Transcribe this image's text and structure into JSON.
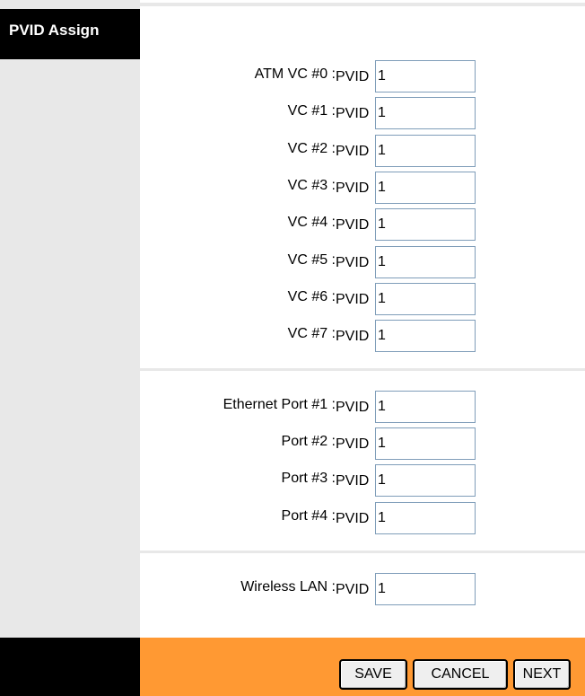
{
  "section": {
    "title": "PVID Assign"
  },
  "pvid_label": "PVID",
  "vc_rows": [
    {
      "label": "ATM VC #0 :",
      "value": "1"
    },
    {
      "label": "VC #1 :",
      "value": "1"
    },
    {
      "label": "VC #2 :",
      "value": "1"
    },
    {
      "label": "VC #3 :",
      "value": "1"
    },
    {
      "label": "VC #4 :",
      "value": "1"
    },
    {
      "label": "VC #5 :",
      "value": "1"
    },
    {
      "label": "VC #6 :",
      "value": "1"
    },
    {
      "label": "VC #7 :",
      "value": "1"
    }
  ],
  "port_rows": [
    {
      "label": "Ethernet Port #1 :",
      "value": "1"
    },
    {
      "label": "Port #2 :",
      "value": "1"
    },
    {
      "label": "Port #3 :",
      "value": "1"
    },
    {
      "label": "Port #4 :",
      "value": "1"
    }
  ],
  "wlan_row": {
    "label": "Wireless LAN :",
    "value": "1"
  },
  "buttons": {
    "save": "SAVE",
    "cancel": "CANCEL",
    "next": "NEXT"
  }
}
